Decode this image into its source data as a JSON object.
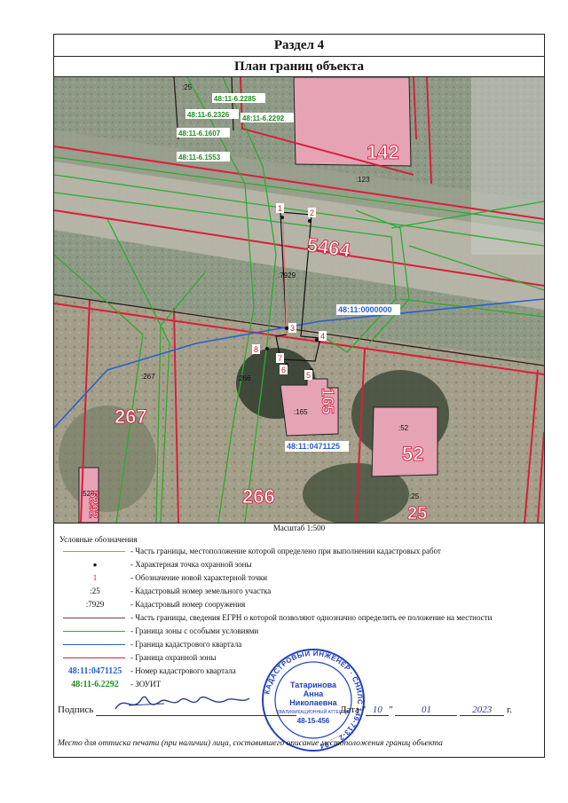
{
  "section_title": "Раздел 4",
  "plan_title": "План границ объекта",
  "map": {
    "labels": [
      ":25",
      ":123",
      ":7929",
      ":267",
      ":266",
      ":165",
      ":52",
      ":25",
      ":5292"
    ],
    "house_numbers": [
      "142",
      "5464",
      "267",
      "266",
      "165",
      "52",
      "25",
      "5292"
    ],
    "zouit_labels": [
      "48:11-6.2285",
      "48:11-6.2326",
      "48:11-6.2292",
      "48:11-6.1607",
      "48:11-6.1553"
    ],
    "quarter_labels": [
      "48:11:0000000",
      "48:11:0471125"
    ],
    "points": [
      "1",
      "2",
      "3",
      "4",
      "5",
      "6",
      "7",
      "8"
    ]
  },
  "scale": "Масштаб 1:500",
  "legend": {
    "title": "Условные обозначения",
    "items": [
      {
        "symbol": "",
        "text": "- Часть границы, местоположение которой определено при выполнении кадастровых работ"
      },
      {
        "symbol": "•",
        "text": "- Характерная точка охранной зоны"
      },
      {
        "symbol": "1",
        "text": "- Обозначение новой характерной точки"
      },
      {
        "symbol": ":25",
        "text": "- Кадастровый номер земельного участка"
      },
      {
        "symbol": ":7929",
        "text": "- Кадастровый номер сооружения"
      },
      {
        "symbol": "",
        "text": "- Часть границы, сведения ЕГРН о которой позволяют однозначно определить ее положение на местности"
      },
      {
        "symbol": "",
        "text": "- Граница зоны с особыми условиями"
      },
      {
        "symbol": "",
        "text": "- Граница кадастрового квартала"
      },
      {
        "symbol": "",
        "text": "- Граница охранной зоны"
      },
      {
        "symbol": "48:11:0471125",
        "text": "- Номер кадастрового квартала"
      },
      {
        "symbol": "48:11-6.2292",
        "text": "- ЗОУИТ"
      }
    ]
  },
  "colors": {
    "boundary_new": "#e57a7a",
    "point": "#111111",
    "point_label": "#d42020",
    "egrn_line": "#7a3b3b",
    "zouit": "#2faa2f",
    "quarter": "#2a5fd0",
    "guard_zone": "#d81f3a",
    "stamp": "#1f3fbf"
  },
  "signature": {
    "label": "Подпись",
    "date_label": "Дата",
    "day": "10",
    "month": "01",
    "year": "2023",
    "year_suffix": "г."
  },
  "stamp": {
    "ring_text": "КАДАСТРОВЫЙ ИНЖЕНЕР · СНИЛС 149-713-2__ 94",
    "name_line1": "Татаринова",
    "name_line2": "Анна",
    "name_line3": "Николаевна",
    "cert": "КВАЛИФИКАЦИОННЫЙ АТТЕСТАТ",
    "cert_number": "48-15-456"
  },
  "footer": "Место для оттиска печати (при наличии) лица, составившего описание местоположения границ объекта"
}
